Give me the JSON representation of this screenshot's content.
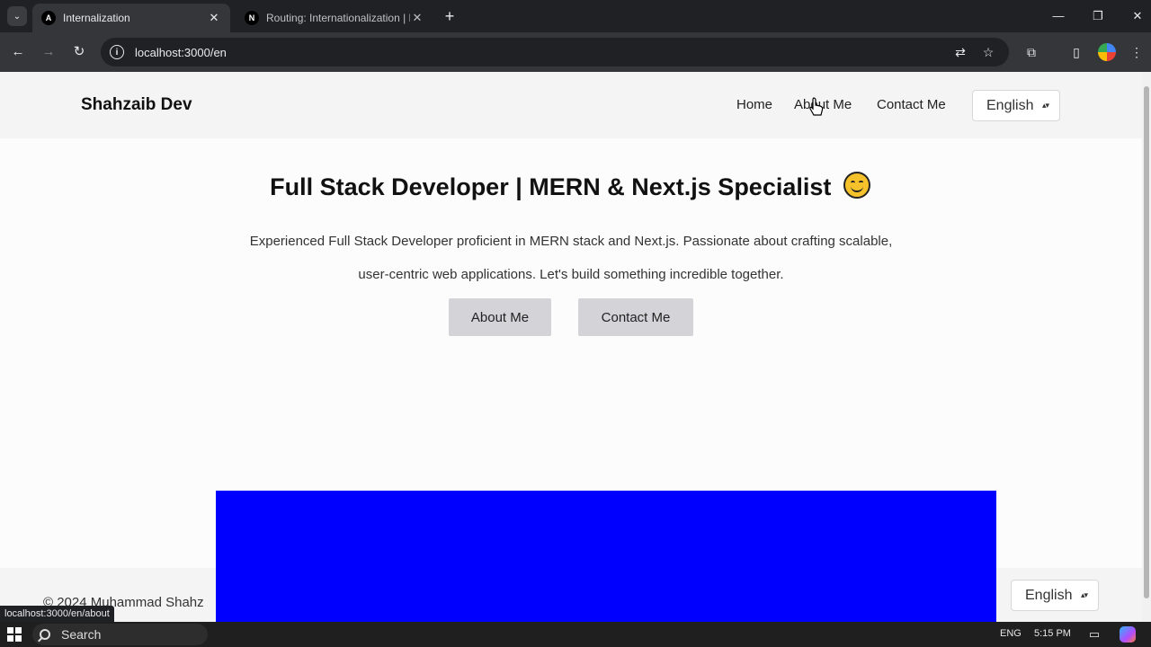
{
  "browser": {
    "tabs": [
      {
        "title": "Internalization",
        "active": true,
        "favicon": "A"
      },
      {
        "title": "Routing: Internationalization | N",
        "active": false,
        "favicon": "N"
      }
    ],
    "url": "localhost:3000/en",
    "status_url": "localhost:3000/en/about"
  },
  "site": {
    "logo": "Shahzaib Dev",
    "nav": [
      "Home",
      "About Me",
      "Contact Me"
    ],
    "language": "English",
    "hero": {
      "title": "Full Stack Developer | MERN & Next.js Specialist",
      "description_line1": "Experienced Full Stack Developer proficient in MERN stack and Next.js. Passionate about crafting scalable,",
      "description_line2": "user-centric web applications. Let's build something incredible together.",
      "buttons": [
        "About Me",
        "Contact Me"
      ]
    },
    "footer": {
      "copyright": "© 2024 Muhammad Shahz",
      "language": "English"
    }
  },
  "taskbar": {
    "search": "Search",
    "language": "ENG",
    "time": "5:15 PM"
  },
  "colors": {
    "overlay": "#0000ff",
    "button_bg": "#d4d4d8",
    "header_bg": "#f4f4f5"
  }
}
